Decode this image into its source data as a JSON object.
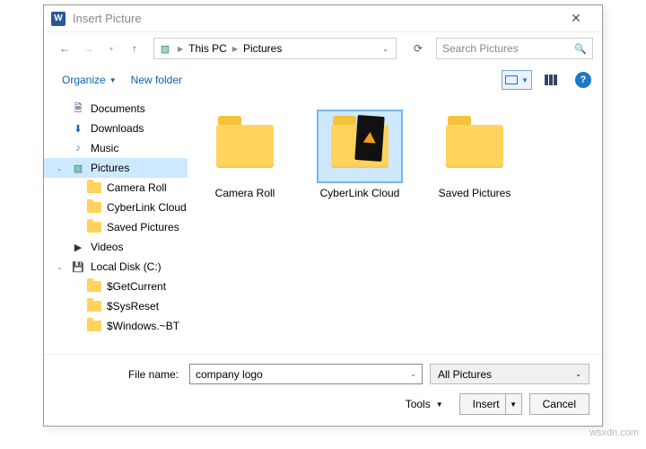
{
  "window": {
    "title": "Insert Picture"
  },
  "nav": {
    "breadcrumb": [
      "This PC",
      "Pictures"
    ],
    "search_placeholder": "Search Pictures"
  },
  "toolbar": {
    "organize": "Organize",
    "new_folder": "New folder"
  },
  "tree": {
    "items": [
      {
        "label": "Documents",
        "icon": "doc",
        "level": 0
      },
      {
        "label": "Downloads",
        "icon": "dl",
        "level": 0
      },
      {
        "label": "Music",
        "icon": "mus",
        "level": 0
      },
      {
        "label": "Pictures",
        "icon": "pic",
        "level": 0,
        "selected": true,
        "expanded": true
      },
      {
        "label": "Camera Roll",
        "icon": "folder",
        "level": 1
      },
      {
        "label": "CyberLink Cloud",
        "icon": "folder",
        "level": 1
      },
      {
        "label": "Saved Pictures",
        "icon": "folder",
        "level": 1
      },
      {
        "label": "Videos",
        "icon": "vid",
        "level": 0
      },
      {
        "label": "Local Disk (C:)",
        "icon": "disk",
        "level": 0,
        "expanded": true
      },
      {
        "label": "$GetCurrent",
        "icon": "folder",
        "level": 1
      },
      {
        "label": "$SysReset",
        "icon": "folder",
        "level": 1
      },
      {
        "label": "$Windows.~BT",
        "icon": "folder",
        "level": 1
      }
    ]
  },
  "content": {
    "items": [
      {
        "label": "Camera Roll",
        "type": "folder",
        "selected": false
      },
      {
        "label": "CyberLink Cloud",
        "type": "folder-media",
        "selected": true
      },
      {
        "label": "Saved Pictures",
        "type": "folder",
        "selected": false
      }
    ]
  },
  "footer": {
    "filename_label": "File name:",
    "filename_value": "company logo",
    "filter_label": "All Pictures",
    "tools_label": "Tools",
    "insert_label": "Insert",
    "cancel_label": "Cancel"
  },
  "watermark": "wsxdn.com"
}
